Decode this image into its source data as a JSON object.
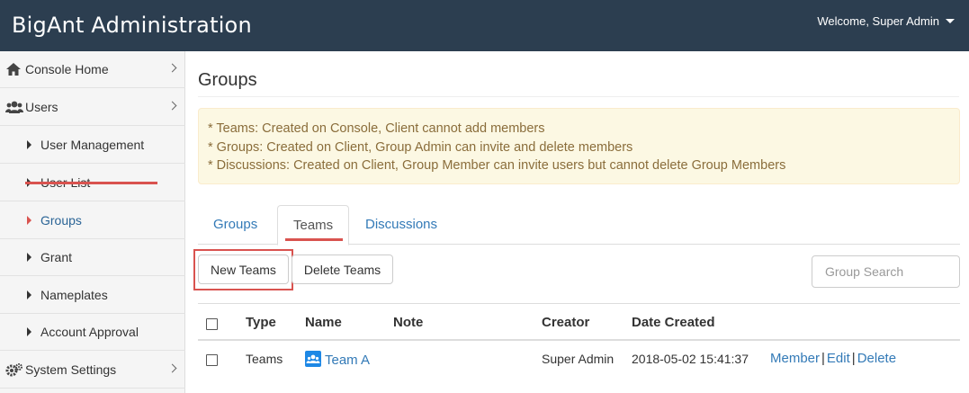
{
  "header": {
    "brand": "BigAnt Administration",
    "welcome": "Welcome, Super Admin"
  },
  "sidebar": {
    "items": [
      {
        "label": "Console Home",
        "icon": "home-icon",
        "type": "top"
      },
      {
        "label": "Users",
        "icon": "users-icon",
        "type": "top"
      },
      {
        "label": "User Management",
        "type": "sub"
      },
      {
        "label": "User List",
        "type": "sub"
      },
      {
        "label": "Groups",
        "type": "sub",
        "active": true
      },
      {
        "label": "Grant",
        "type": "sub"
      },
      {
        "label": "Nameplates",
        "type": "sub"
      },
      {
        "label": "Account Approval",
        "type": "sub"
      },
      {
        "label": "System Settings",
        "icon": "gears-icon",
        "type": "top"
      }
    ]
  },
  "main": {
    "title": "Groups",
    "alert": {
      "lines": [
        "* Teams: Created on Console, Client cannot add members",
        "* Groups: Created on Client, Group Admin can invite and delete members",
        "* Discussions: Created on Client, Group Member can invite users but cannot delete Group Members"
      ]
    },
    "tabs": [
      {
        "label": "Groups"
      },
      {
        "label": "Teams",
        "active": true
      },
      {
        "label": "Discussions"
      }
    ],
    "toolbar": {
      "new_label": "New Teams",
      "delete_label": "Delete Teams",
      "search_placeholder": "Group Search"
    },
    "table": {
      "headers": [
        "Type",
        "Name",
        "Note",
        "Creator",
        "Date Created"
      ],
      "rows": [
        {
          "type": "Teams",
          "name": "Team A",
          "note": "",
          "creator": "Super Admin",
          "date_created": "2018-05-02 15:41:37",
          "actions": [
            "Member",
            "Edit",
            "Delete"
          ]
        }
      ]
    }
  },
  "colors": {
    "header_bg": "#2c3e50",
    "accent_red": "#d9534f",
    "link_blue": "#337ab7",
    "alert_bg": "#fcf8e3",
    "alert_text": "#8a6d3b"
  }
}
